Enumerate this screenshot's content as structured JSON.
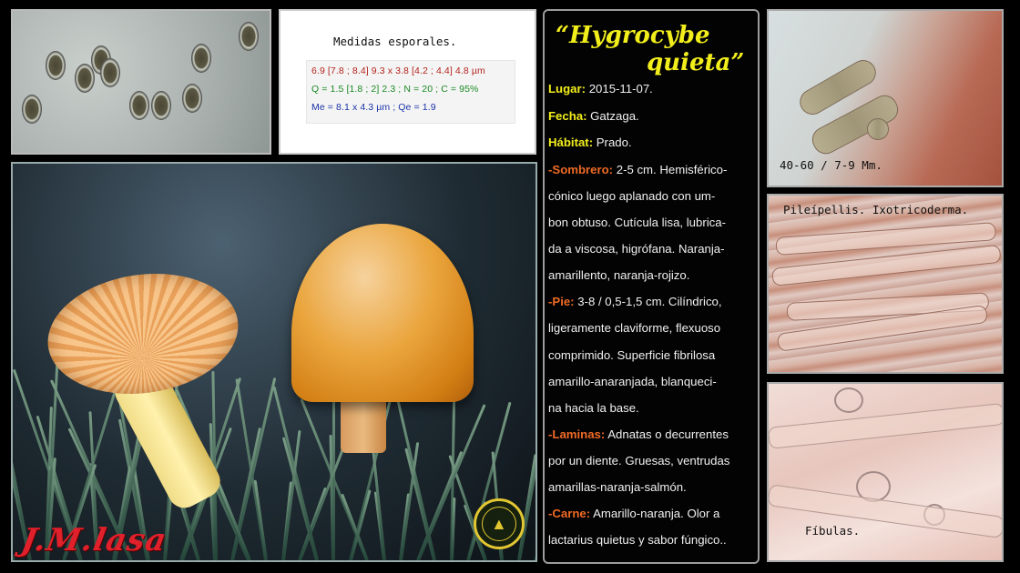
{
  "measurements": {
    "title": "Medidas esporales.",
    "line1": "6.9 [7.8 ; 8.4] 9.3 x 3.8 [4.2 ; 4.4] 4.8 µm",
    "line2": "Q = 1.5 [1.8 ; 2] 2.3 ; N = 20 ; C = 95%",
    "line3": "Me = 8.1 x 4.3 µm ; Qe = 1.9",
    "colors": {
      "line1": "#b3241c",
      "line2": "#1a8a23",
      "line3": "#1b33a8"
    }
  },
  "species": {
    "line1": "“Hygrocybe",
    "line2": "quieta”",
    "color": "#f2ee1c"
  },
  "info": {
    "lugar": {
      "label": "Lugar:",
      "value": " 2015-11-07."
    },
    "fecha": {
      "label": "Fecha:",
      "value": " Gatzaga."
    },
    "habitat": {
      "label": "Hábitat:",
      "value": " Prado."
    },
    "sombrero": {
      "label": "-Sombrero:",
      "lines": [
        "  2-5 cm. Hemisférico-",
        "cónico luego aplanado con um-",
        "bon obtuso. Cutícula lisa, lubrica-",
        "da a viscosa, higrófana. Naranja-",
        "amarillento, naranja-rojizo."
      ]
    },
    "pie": {
      "label": "-Pie:",
      "lines": [
        " 3-8 / 0,5-1,5 cm. Cilíndrico,",
        "ligeramente claviforme, flexuoso",
        "comprimido. Superficie fibrilosa",
        "amarillo-anaranjada, blanqueci-",
        "na hacia la base."
      ]
    },
    "laminas": {
      "label": "-Laminas:",
      "lines": [
        " Adnatas o decurrentes",
        "por un diente. Gruesas, ventrudas",
        "amarillas-naranja-salmón."
      ]
    },
    "carne": {
      "label": "-Carne:",
      "lines": [
        " Amarillo-naranja. Olor a",
        "lactarius quietus y sabor fúngico.."
      ]
    },
    "label_colors": {
      "yellow": "#f2ee1c",
      "orange": "#ef6a25"
    }
  },
  "micrographs": {
    "cystidia": "40-60 / 7-9 Mm.",
    "pileipellis": "Pileípellis. Ixotricoderma.",
    "clamps": "Fíbulas."
  },
  "photo": {
    "signature": "J.M.lasa",
    "emblem_icon": "mushroom-emblem-icon",
    "emblem_color": "#e2c631"
  }
}
